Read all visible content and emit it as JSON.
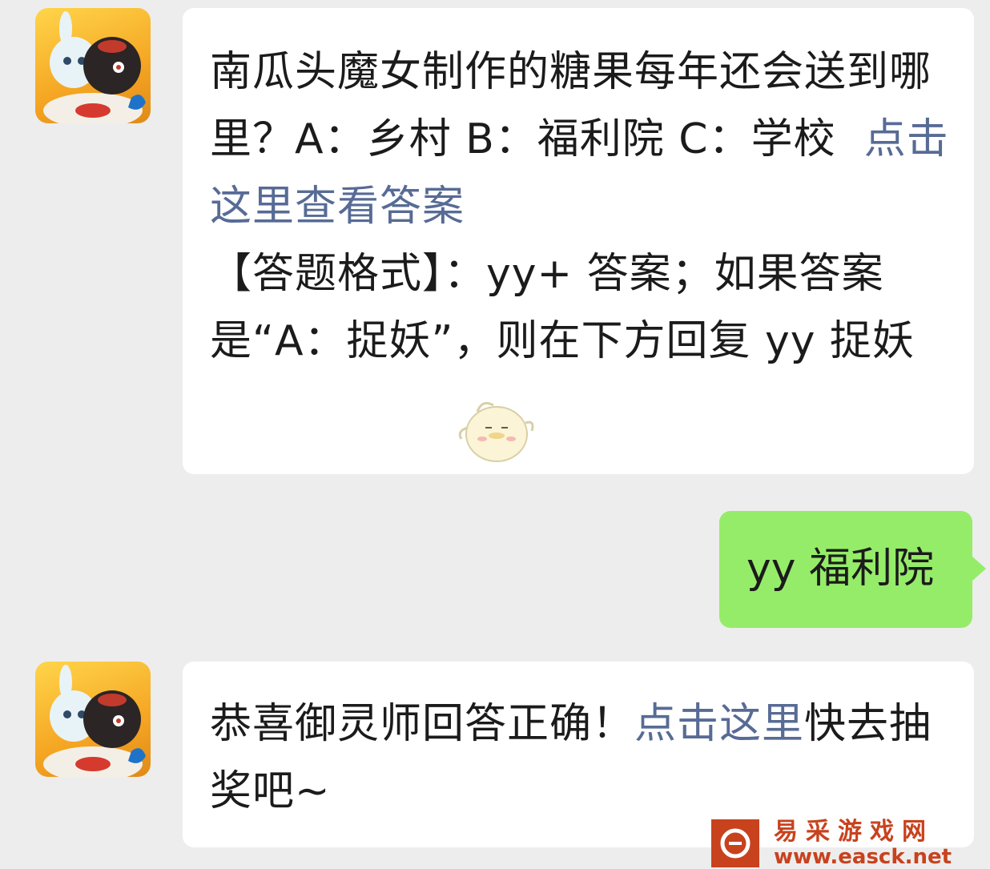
{
  "messages": [
    {
      "sender": "official-account",
      "question_text": "南瓜头魔女制作的糖果每年还会送到哪里？A：乡村 B：福利院 C：学校",
      "question_link": "点击这里查看答案",
      "format_text": "【答题格式】：yy+ 答案；如果答案是“A：捉妖”，则在下方回复 yy 捉妖"
    },
    {
      "sender": "me",
      "text": "yy 福利院"
    },
    {
      "sender": "official-account",
      "text_before": "恭喜御灵师回答正确！",
      "link": "点击这里",
      "text_after": "快去抽奖吧~"
    }
  ],
  "watermark": {
    "name": "易采游戏网",
    "url": "www.easck.net"
  },
  "colors": {
    "background": "#ededed",
    "link": "#576b95",
    "my_bubble": "#95ec69",
    "watermark": "#c8421e"
  }
}
